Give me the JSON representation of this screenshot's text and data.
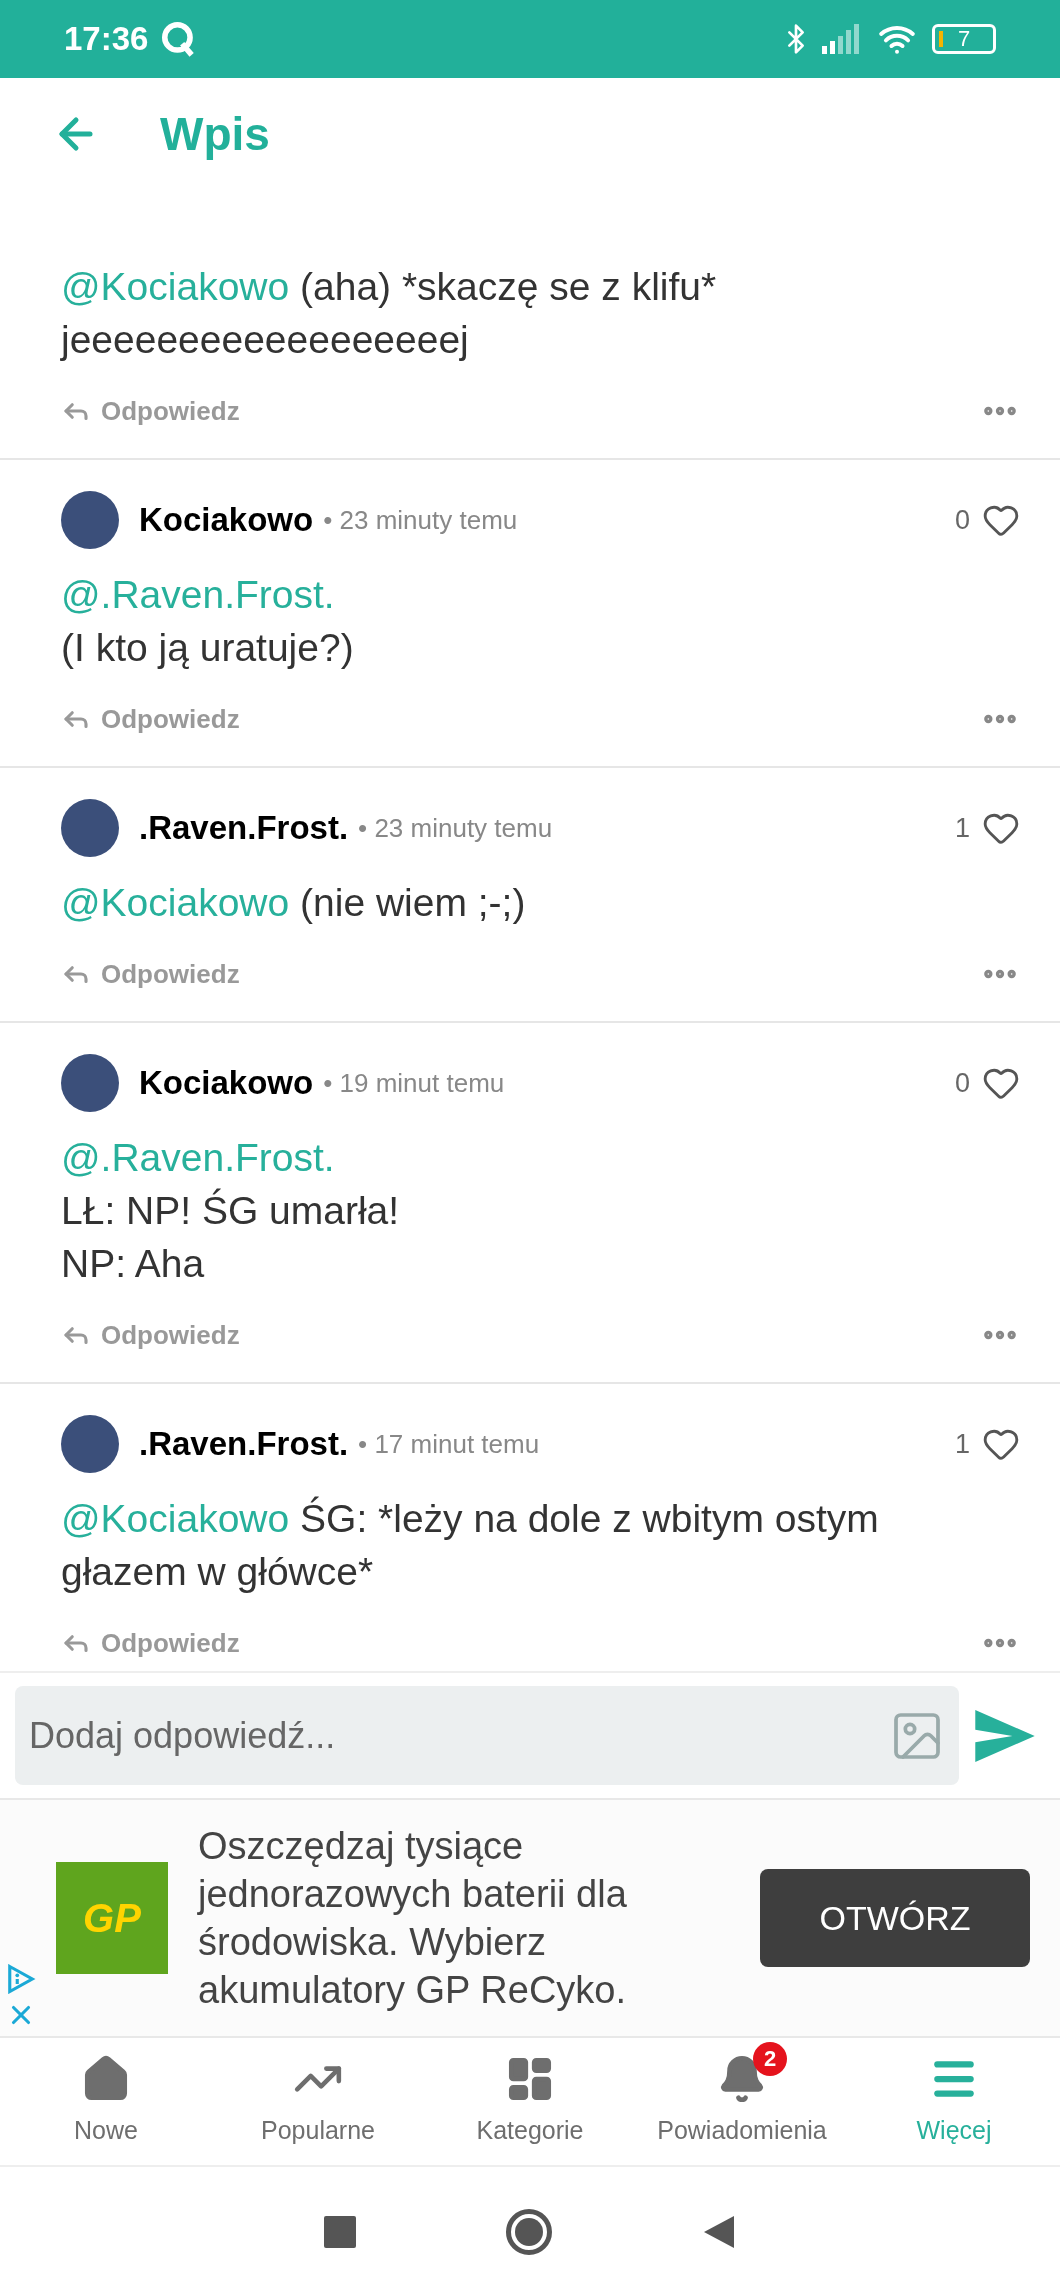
{
  "status_bar": {
    "time": "17:36",
    "battery": "7"
  },
  "header": {
    "title": "Wpis"
  },
  "comments": [
    {
      "paragraphs": [
        [
          {
            "kind": "mention",
            "text": "@Kociakowo"
          },
          {
            "kind": "text",
            "text": "(aha) *skaczę se z klifu* jeeeeeeeeeeeeeeeeeej"
          }
        ]
      ],
      "reply": "Odpowiedz"
    },
    {
      "author": "Kociakowo",
      "time": "• 23 minuty temu",
      "likes": "0",
      "paragraphs": [
        [
          {
            "kind": "mention",
            "text": "@.Raven.Frost."
          }
        ],
        [
          {
            "kind": "text",
            "text": "(I kto ją uratuje?)"
          }
        ]
      ],
      "reply": "Odpowiedz"
    },
    {
      "author": ".Raven.Frost.",
      "time": "• 23 minuty temu",
      "likes": "1",
      "paragraphs": [
        [
          {
            "kind": "mention",
            "text": "@Kociakowo"
          },
          {
            "kind": "text",
            "text": "(nie wiem ;-;)"
          }
        ]
      ],
      "reply": "Odpowiedz"
    },
    {
      "author": "Kociakowo",
      "time": "• 19 minut temu",
      "likes": "0",
      "paragraphs": [
        [
          {
            "kind": "mention",
            "text": "@.Raven.Frost."
          }
        ],
        [
          {
            "kind": "text",
            "text": "LŁ: NP! ŚG umarła!"
          }
        ],
        [
          {
            "kind": "text",
            "text": "NP: Aha"
          }
        ]
      ],
      "reply": "Odpowiedz"
    },
    {
      "author": ".Raven.Frost.",
      "time": "• 17 minut temu",
      "likes": "1",
      "paragraphs": [
        [
          {
            "kind": "mention",
            "text": "@Kociakowo"
          },
          {
            "kind": "text",
            "text": "ŚG: *leży na dole z wbitym ostym głazem w główce*"
          }
        ]
      ],
      "reply": "Odpowiedz"
    }
  ],
  "reply_input": {
    "placeholder": "Dodaj odpowiedź..."
  },
  "ad": {
    "logo_text": "GP",
    "text": "Oszczędzaj tysiące jednorazowych baterii dla środowiska. Wybierz akumulatory GP ReCyko.",
    "button": "OTWÓRZ"
  },
  "bottom_nav": [
    {
      "kind": "home",
      "label": "Nowe",
      "selected": false
    },
    {
      "kind": "trending",
      "label": "Popularne",
      "selected": false
    },
    {
      "kind": "categories",
      "label": "Kategorie",
      "selected": false
    },
    {
      "kind": "notifications",
      "label": "Powiadomienia",
      "selected": false,
      "badge": "2"
    },
    {
      "kind": "more",
      "label": "Więcej",
      "selected": true
    }
  ]
}
